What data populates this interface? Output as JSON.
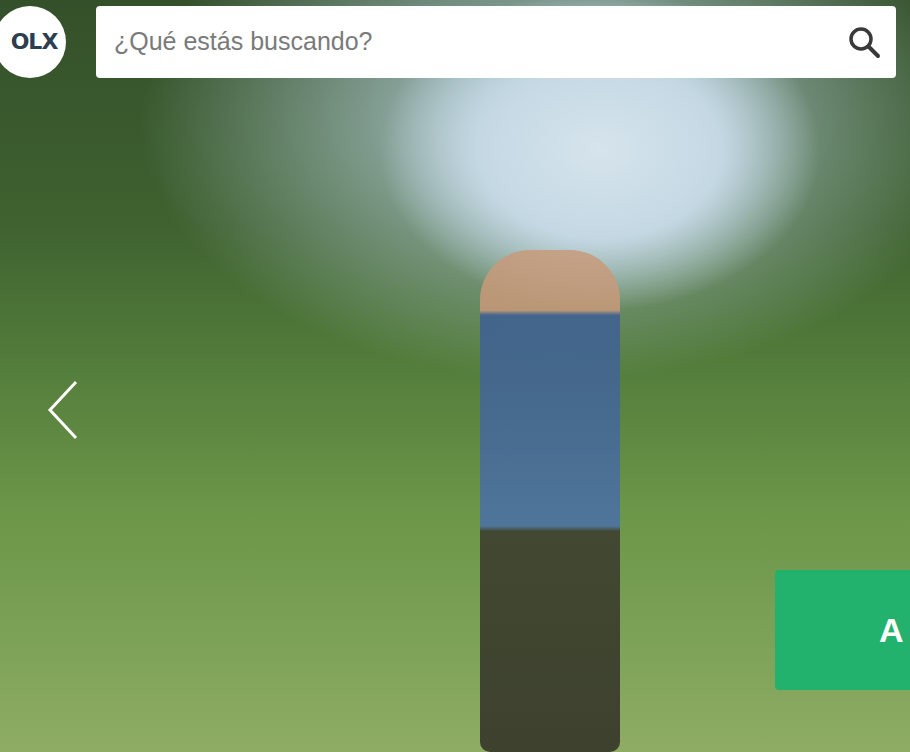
{
  "logo": {
    "text": "OLX"
  },
  "search": {
    "placeholder": "¿Qué estás buscando?"
  },
  "cta_button": {
    "label": "A"
  }
}
